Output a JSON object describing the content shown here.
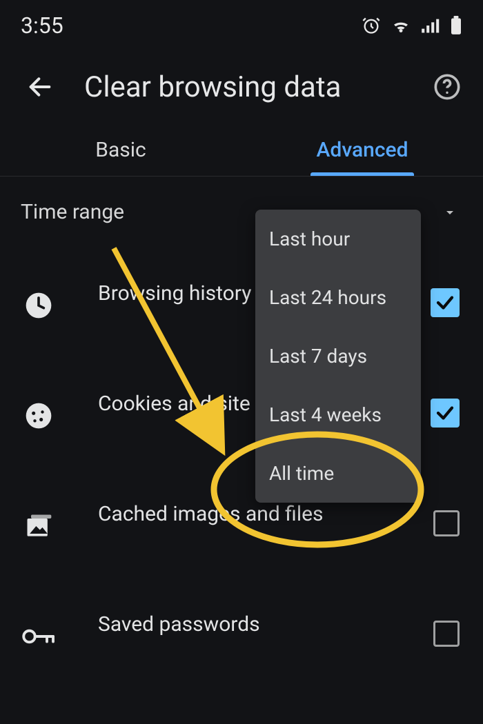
{
  "status": {
    "time": "3:55"
  },
  "header": {
    "title": "Clear browsing data"
  },
  "tabs": {
    "basic": "Basic",
    "advanced": "Advanced",
    "active": "advanced"
  },
  "timerange": {
    "label": "Time range",
    "options": [
      "Last hour",
      "Last 24 hours",
      "Last 7 days",
      "Last 4 weeks",
      "All time"
    ],
    "selected": "Last hour"
  },
  "items": [
    {
      "id": "browsing-history",
      "label": "Browsing history",
      "checked": true
    },
    {
      "id": "cookies",
      "label": "Cookies and site",
      "checked": true
    },
    {
      "id": "cache",
      "label": "Cached images and files",
      "checked": false
    },
    {
      "id": "passwords",
      "label": "Saved passwords",
      "checked": false
    }
  ],
  "colors": {
    "accent": "#59a9ff",
    "checkbox": "#6ec7ff",
    "annotation": "#f2c431",
    "bg": "#121316",
    "dropdown": "#3c3d40"
  }
}
